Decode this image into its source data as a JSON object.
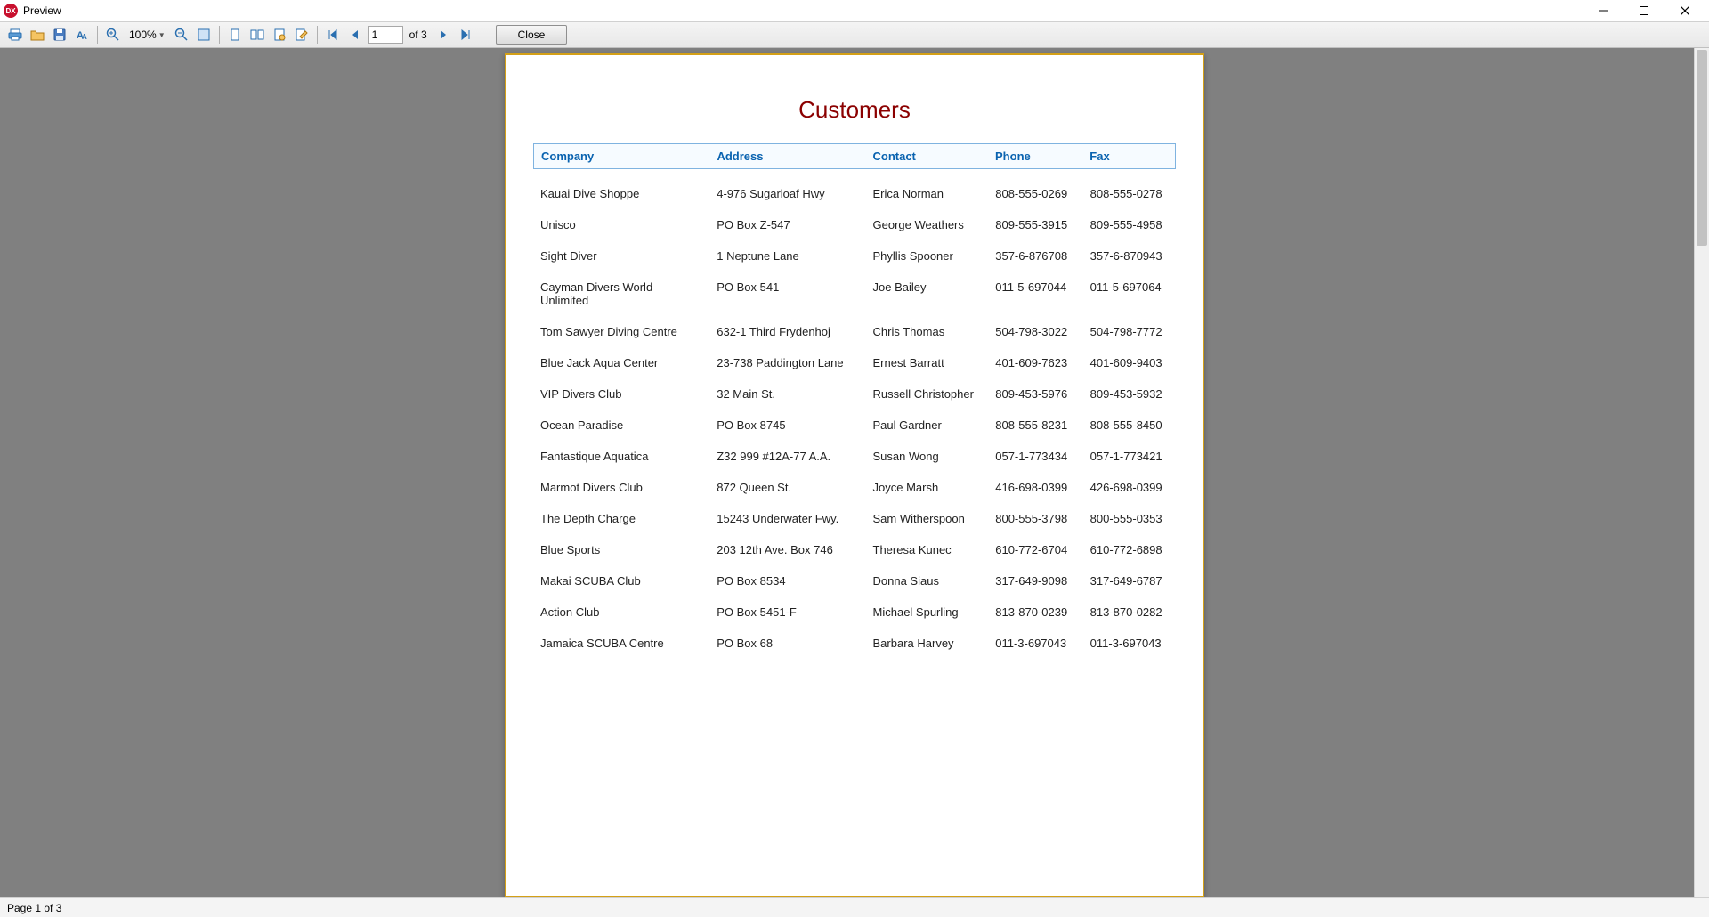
{
  "window": {
    "title": "Preview",
    "app_icon_text": "DX"
  },
  "toolbar": {
    "zoom_label": "100%",
    "page_value": "1",
    "page_of": "of 3",
    "close_label": "Close"
  },
  "report": {
    "title": "Customers",
    "columns": {
      "company": "Company",
      "address": "Address",
      "contact": "Contact",
      "phone": "Phone",
      "fax": "Fax"
    },
    "rows": [
      {
        "company": "Kauai Dive Shoppe",
        "address": "4-976 Sugarloaf Hwy",
        "contact": "Erica Norman",
        "phone": "808-555-0269",
        "fax": "808-555-0278"
      },
      {
        "company": "Unisco",
        "address": "PO Box Z-547",
        "contact": "George Weathers",
        "phone": "809-555-3915",
        "fax": "809-555-4958"
      },
      {
        "company": "Sight Diver",
        "address": "1 Neptune Lane",
        "contact": "Phyllis Spooner",
        "phone": "357-6-876708",
        "fax": "357-6-870943"
      },
      {
        "company": "Cayman Divers World Unlimited",
        "address": "PO Box 541",
        "contact": "Joe Bailey",
        "phone": "011-5-697044",
        "fax": "011-5-697064"
      },
      {
        "company": "Tom Sawyer Diving Centre",
        "address": "632-1 Third Frydenhoj",
        "contact": "Chris Thomas",
        "phone": "504-798-3022",
        "fax": "504-798-7772"
      },
      {
        "company": "Blue Jack Aqua Center",
        "address": "23-738 Paddington Lane",
        "contact": "Ernest Barratt",
        "phone": "401-609-7623",
        "fax": "401-609-9403"
      },
      {
        "company": "VIP Divers Club",
        "address": "32 Main St.",
        "contact": "Russell Christopher",
        "phone": "809-453-5976",
        "fax": "809-453-5932"
      },
      {
        "company": "Ocean Paradise",
        "address": "PO Box 8745",
        "contact": "Paul Gardner",
        "phone": "808-555-8231",
        "fax": "808-555-8450"
      },
      {
        "company": "Fantastique Aquatica",
        "address": "Z32 999 #12A-77 A.A.",
        "contact": "Susan Wong",
        "phone": "057-1-773434",
        "fax": "057-1-773421"
      },
      {
        "company": "Marmot Divers Club",
        "address": "872 Queen St.",
        "contact": "Joyce Marsh",
        "phone": "416-698-0399",
        "fax": "426-698-0399"
      },
      {
        "company": "The Depth Charge",
        "address": "15243 Underwater Fwy.",
        "contact": "Sam Witherspoon",
        "phone": "800-555-3798",
        "fax": "800-555-0353"
      },
      {
        "company": "Blue Sports",
        "address": "203 12th Ave. Box 746",
        "contact": "Theresa Kunec",
        "phone": "610-772-6704",
        "fax": "610-772-6898"
      },
      {
        "company": "Makai SCUBA Club",
        "address": "PO Box 8534",
        "contact": "Donna Siaus",
        "phone": "317-649-9098",
        "fax": "317-649-6787"
      },
      {
        "company": "Action Club",
        "address": "PO Box 5451-F",
        "contact": "Michael Spurling",
        "phone": "813-870-0239",
        "fax": "813-870-0282"
      },
      {
        "company": "Jamaica SCUBA Centre",
        "address": "PO Box 68",
        "contact": "Barbara Harvey",
        "phone": "011-3-697043",
        "fax": "011-3-697043"
      }
    ]
  },
  "status": {
    "text": "Page 1 of 3"
  }
}
